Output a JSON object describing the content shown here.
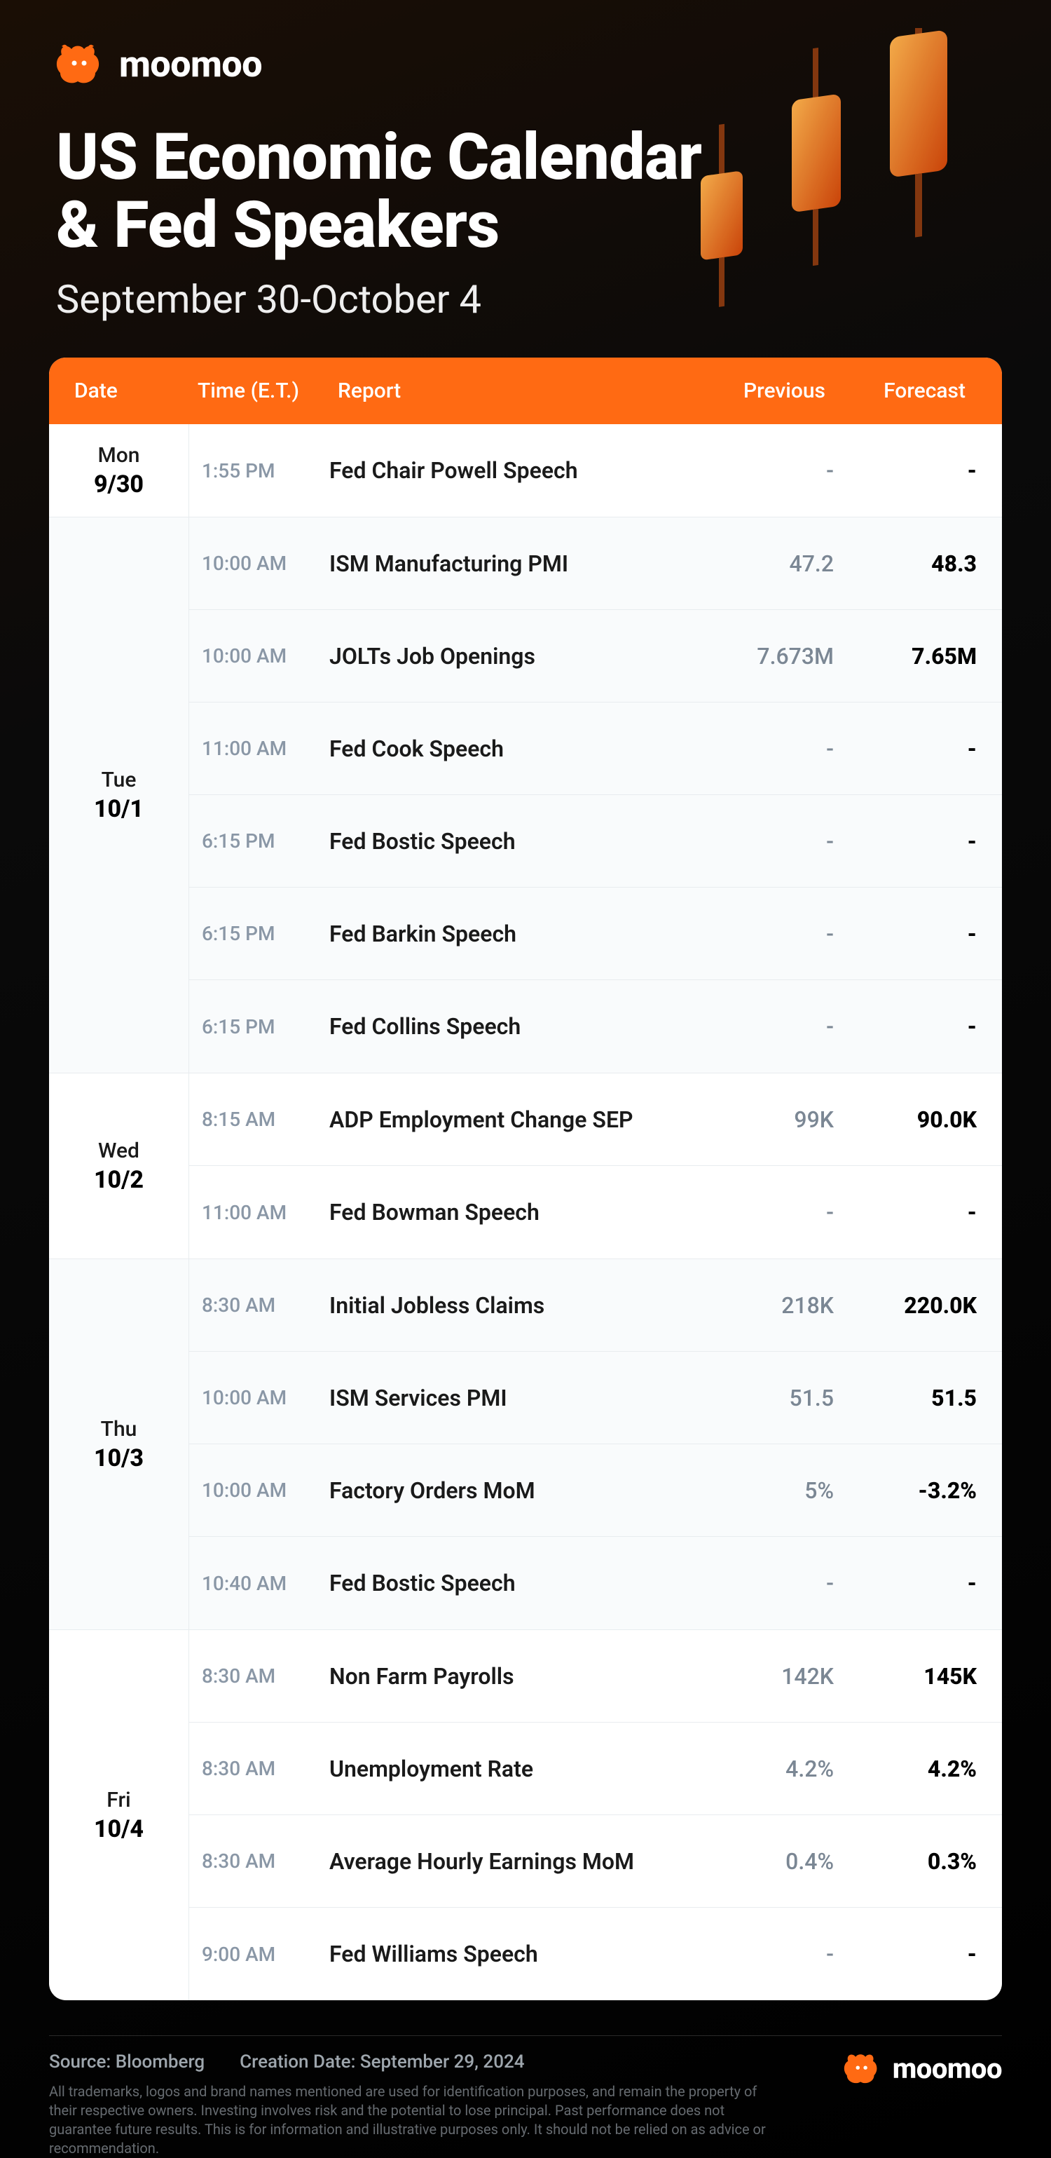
{
  "brand": "moomoo",
  "title_line1": "US Economic Calendar",
  "title_line2": "& Fed Speakers",
  "subtitle": "September 30-October 4",
  "columns": {
    "date": "Date",
    "time": "Time (E.T.)",
    "report": "Report",
    "previous": "Previous",
    "forecast": "Forecast"
  },
  "days": [
    {
      "name": "Mon",
      "date": "9/30",
      "rows": [
        {
          "time": "1:55 PM",
          "report": "Fed Chair Powell Speech",
          "previous": "-",
          "forecast": "-"
        }
      ]
    },
    {
      "name": "Tue",
      "date": "10/1",
      "rows": [
        {
          "time": "10:00 AM",
          "report": "ISM Manufacturing PMI",
          "previous": "47.2",
          "forecast": "48.3"
        },
        {
          "time": "10:00 AM",
          "report": "JOLTs Job Openings",
          "previous": "7.673M",
          "forecast": "7.65M"
        },
        {
          "time": "11:00 AM",
          "report": "Fed Cook Speech",
          "previous": "-",
          "forecast": "-"
        },
        {
          "time": "6:15 PM",
          "report": "Fed Bostic Speech",
          "previous": "-",
          "forecast": "-"
        },
        {
          "time": "6:15 PM",
          "report": "Fed Barkin Speech",
          "previous": "-",
          "forecast": "-"
        },
        {
          "time": "6:15 PM",
          "report": "Fed Collins Speech",
          "previous": "-",
          "forecast": "-"
        }
      ]
    },
    {
      "name": "Wed",
      "date": "10/2",
      "rows": [
        {
          "time": "8:15 AM",
          "report": "ADP Employment Change SEP",
          "previous": "99K",
          "forecast": "90.0K"
        },
        {
          "time": "11:00 AM",
          "report": "Fed Bowman Speech",
          "previous": "-",
          "forecast": "-"
        }
      ]
    },
    {
      "name": "Thu",
      "date": "10/3",
      "rows": [
        {
          "time": "8:30 AM",
          "report": "Initial Jobless Claims",
          "previous": "218K",
          "forecast": "220.0K"
        },
        {
          "time": "10:00 AM",
          "report": "ISM Services PMI",
          "previous": "51.5",
          "forecast": "51.5"
        },
        {
          "time": "10:00 AM",
          "report": "Factory Orders MoM",
          "previous": "5%",
          "forecast": "-3.2%"
        },
        {
          "time": "10:40 AM",
          "report": "Fed Bostic Speech",
          "previous": "-",
          "forecast": "-"
        }
      ]
    },
    {
      "name": "Fri",
      "date": "10/4",
      "rows": [
        {
          "time": "8:30 AM",
          "report": "Non Farm Payrolls",
          "previous": "142K",
          "forecast": "145K"
        },
        {
          "time": "8:30 AM",
          "report": "Unemployment Rate",
          "previous": "4.2%",
          "forecast": "4.2%"
        },
        {
          "time": "8:30 AM",
          "report": "Average Hourly Earnings MoM",
          "previous": "0.4%",
          "forecast": "0.3%"
        },
        {
          "time": "9:00 AM",
          "report": "Fed Williams Speech",
          "previous": "-",
          "forecast": "-"
        }
      ]
    }
  ],
  "source_label": "Source: Bloomberg",
  "creation_label": "Creation Date: September 29, 2024",
  "disclaimer": "All trademarks, logos and brand names mentioned are used for identification purposes, and remain the property of their respective owners. Investing involves risk and the potential to lose principal. Past performance does not guarantee future results. This is for information and illustrative purposes only. It should not be relied on as advice or recommendation."
}
